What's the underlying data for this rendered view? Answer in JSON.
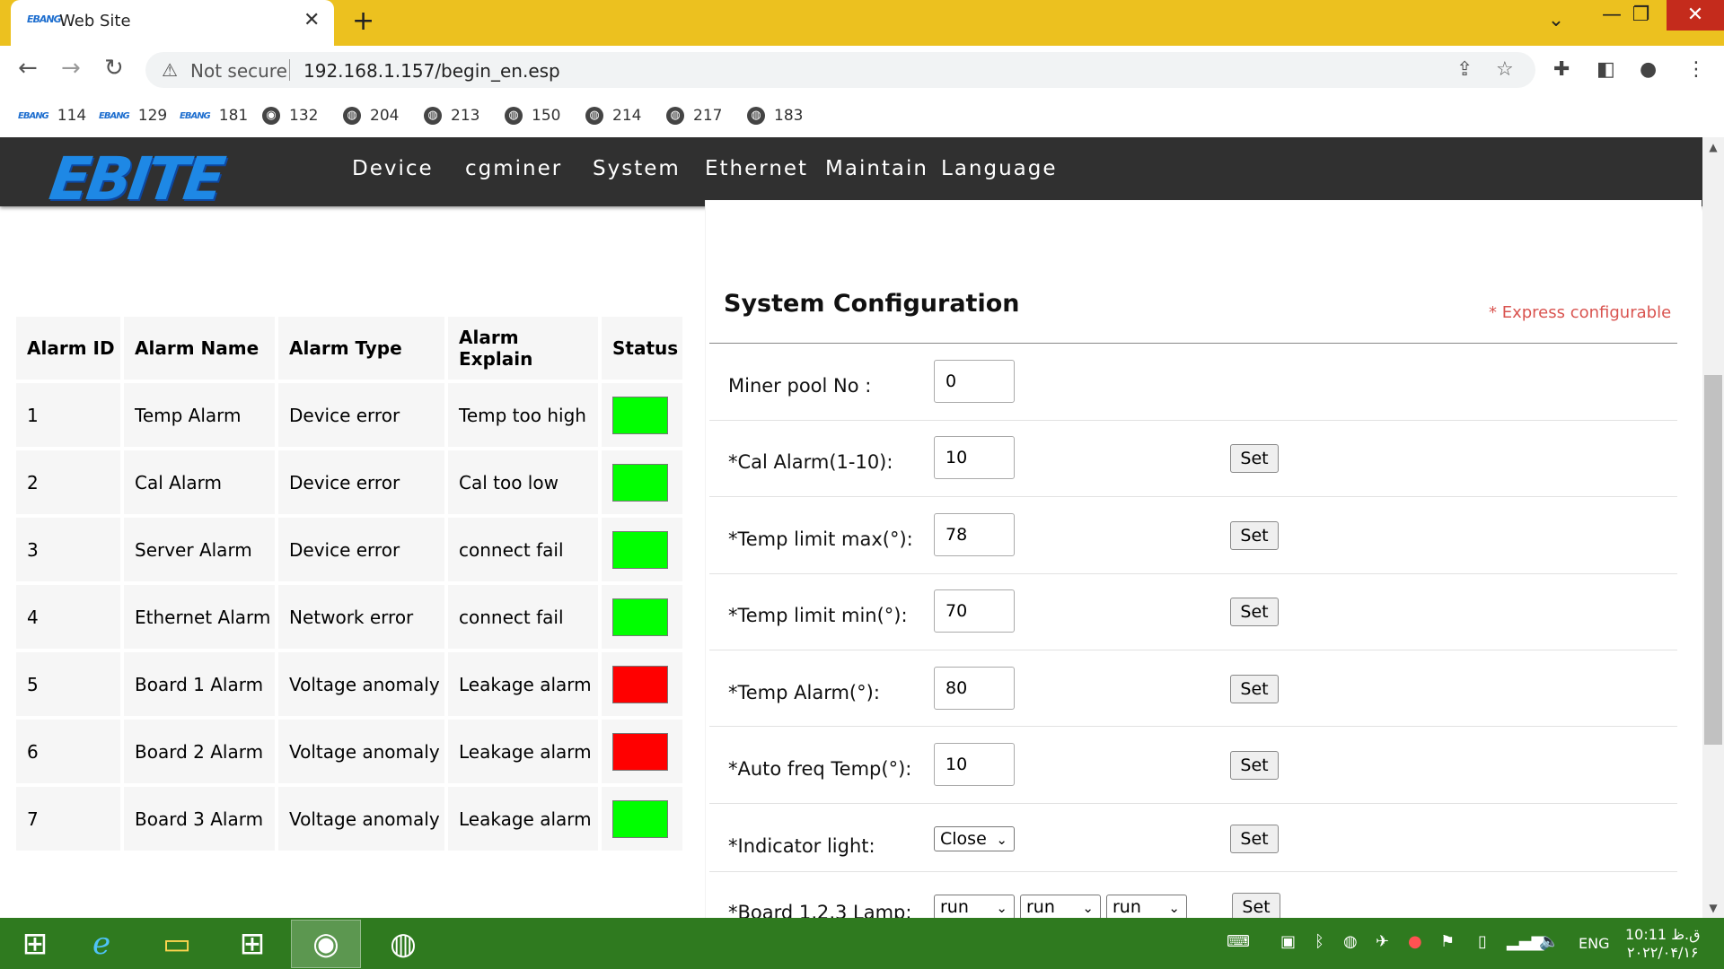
{
  "browser": {
    "tab_title": "Web Site",
    "tab_icon_text": "EBANG",
    "url_security": "Not secure",
    "url": "192.168.1.157/begin_en.esp",
    "bookmarks": [
      {
        "label": "114",
        "icon": "ebang-logo"
      },
      {
        "label": "129",
        "icon": "ebang-logo"
      },
      {
        "label": "181",
        "icon": "ebang-logo"
      },
      {
        "label": "132",
        "icon": "camera-icon"
      },
      {
        "label": "204",
        "icon": "globe-icon"
      },
      {
        "label": "213",
        "icon": "globe-icon"
      },
      {
        "label": "150",
        "icon": "globe-icon"
      },
      {
        "label": "214",
        "icon": "globe-icon"
      },
      {
        "label": "217",
        "icon": "globe-icon"
      },
      {
        "label": "183",
        "icon": "globe-icon"
      }
    ]
  },
  "header": {
    "logo": "EBITE",
    "menu": [
      "Device",
      "cgminer",
      "System",
      "Ethernet",
      "Maintain",
      "Language"
    ]
  },
  "alarm_table": {
    "headers": [
      "Alarm ID",
      "Alarm Name",
      "Alarm Type",
      "Alarm Explain",
      "Status"
    ],
    "rows": [
      {
        "id": "1",
        "name": "Temp Alarm",
        "type": "Device error",
        "explain": "Temp too high",
        "status_color": "#00ff00"
      },
      {
        "id": "2",
        "name": "Cal Alarm",
        "type": "Device error",
        "explain": "Cal too low",
        "status_color": "#00ff00"
      },
      {
        "id": "3",
        "name": "Server Alarm",
        "type": "Device error",
        "explain": "connect fail",
        "status_color": "#00ff00"
      },
      {
        "id": "4",
        "name": "Ethernet Alarm",
        "type": "Network error",
        "explain": "connect fail",
        "status_color": "#00ff00"
      },
      {
        "id": "5",
        "name": "Board 1 Alarm",
        "type": "Voltage anomaly",
        "explain": "Leakage alarm",
        "status_color": "#ff0000"
      },
      {
        "id": "6",
        "name": "Board 2 Alarm",
        "type": "Voltage anomaly",
        "explain": "Leakage alarm",
        "status_color": "#ff0000"
      },
      {
        "id": "7",
        "name": "Board 3 Alarm",
        "type": "Voltage anomaly",
        "explain": "Leakage alarm",
        "status_color": "#00ff00"
      }
    ]
  },
  "config": {
    "title": "System Configuration",
    "express_note": "* Express configurable",
    "set_label": "Set",
    "rows": [
      {
        "label": "Miner pool No :",
        "value": "0"
      },
      {
        "label": "*Cal Alarm(1-10):",
        "value": "10"
      },
      {
        "label": "*Temp limit max(°):",
        "value": "78"
      },
      {
        "label": "*Temp limit min(°):",
        "value": "70"
      },
      {
        "label": "*Temp Alarm(°):",
        "value": "80"
      },
      {
        "label": "*Auto freq Temp(°):",
        "value": "10"
      }
    ],
    "indicator_label": "*Indicator light:",
    "indicator_value": "Close",
    "lamp_label": "*Board 1,2,3 Lamp:",
    "lamp_values": [
      "run",
      "run",
      "run"
    ]
  },
  "taskbar": {
    "language": "ENG",
    "time": "10:11 ق.ظ",
    "date": "۲۰۲۲/۰۴/۱۶"
  }
}
